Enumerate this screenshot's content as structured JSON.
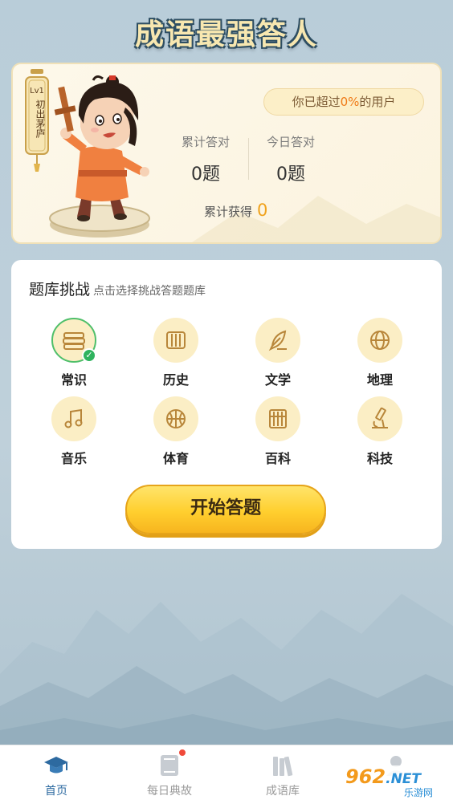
{
  "app_title": "成语最强答人",
  "profile": {
    "level": "Lv1",
    "rank_title": "初出茅庐",
    "percent_prefix": "你已超过",
    "percent_value": "0%",
    "percent_suffix": "的用户",
    "total_label": "累计答对",
    "total_value": "0题",
    "today_label": "今日答对",
    "today_value": "0题",
    "earned_label": "累计获得",
    "earned_value": "0"
  },
  "challenge": {
    "title": "题库挑战",
    "hint": "点击选择挑战答题题库",
    "categories": [
      {
        "label": "常识",
        "icon": "books-icon",
        "selected": true
      },
      {
        "label": "历史",
        "icon": "scroll-icon",
        "selected": false
      },
      {
        "label": "文学",
        "icon": "quill-icon",
        "selected": false
      },
      {
        "label": "地理",
        "icon": "globe-icon",
        "selected": false
      },
      {
        "label": "音乐",
        "icon": "music-note-icon",
        "selected": false
      },
      {
        "label": "体育",
        "icon": "basketball-icon",
        "selected": false
      },
      {
        "label": "百科",
        "icon": "abacus-icon",
        "selected": false
      },
      {
        "label": "科技",
        "icon": "microscope-icon",
        "selected": false
      }
    ],
    "start_button": "开始答题"
  },
  "nav": {
    "items": [
      {
        "label": "首页",
        "icon": "graduation-cap-icon",
        "active": true
      },
      {
        "label": "每日典故",
        "icon": "book-icon",
        "active": false,
        "badge": true
      },
      {
        "label": "成语库",
        "icon": "bookshelf-icon",
        "active": false
      },
      {
        "label": "",
        "icon": "profile-icon",
        "active": false
      }
    ]
  },
  "watermark": {
    "brand": "962",
    "suffix": ".NET",
    "sub": "乐游网"
  },
  "colors": {
    "accent": "#f0a21c",
    "selected": "#2fb35e",
    "nav_active": "#2d6aa0",
    "button": "#ffcf2e"
  }
}
